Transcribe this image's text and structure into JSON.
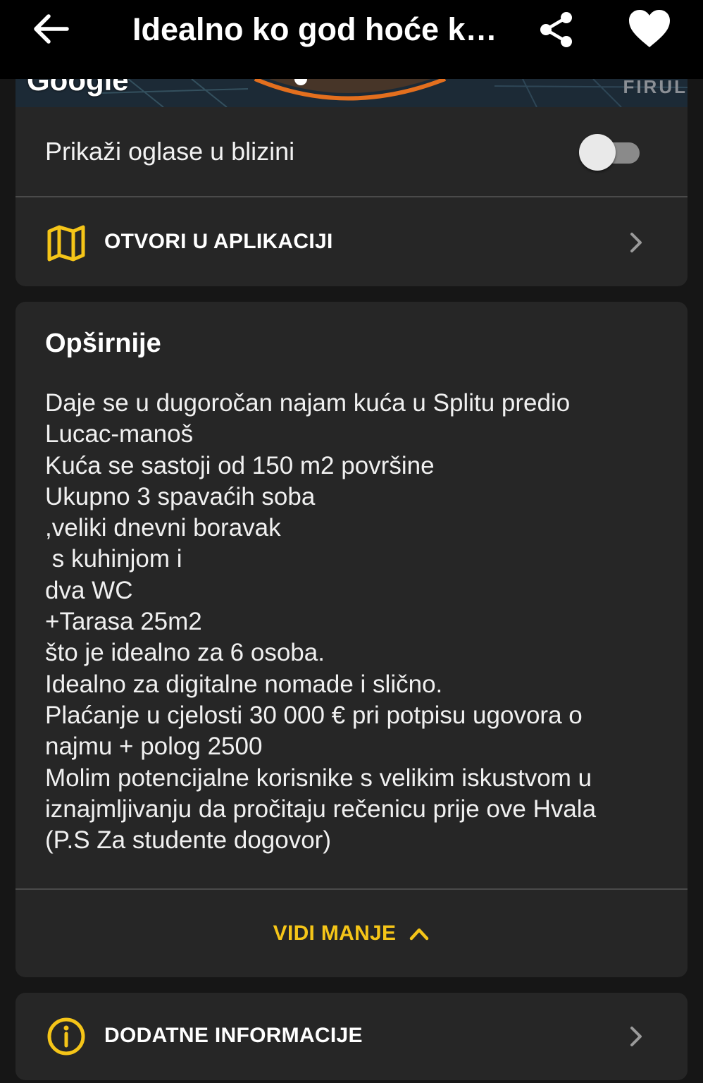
{
  "appbar": {
    "title": "Idealno ko god hoće ku..."
  },
  "map": {
    "brand": "Google",
    "place_label": "FIRUL"
  },
  "location_card": {
    "nearby_label": "Prikaži oglase u blizini",
    "nearby_enabled": false,
    "open_in_app_label": "OTVORI U APLIKACIJI"
  },
  "description": {
    "title": "Opširnije",
    "text": "Daje se u dugoročan najam kuća u Splitu predio\nLucac-manoš\nKuća se sastoji od 150 m2 površine\nUkupno 3 spavaćih soba\n,veliki dnevni boravak\n s kuhinjom i\ndva WC\n+Tarasa 25m2\nšto je idealno za 6 osoba.\nIdealno za digitalne nomade i slično.\nPlaćanje u cjelosti 30 000 € pri potpisu ugovora o\nnajmu + polog 2500\nMolim potencijalne korisnike s velikim iskustvom u\niznajmljivanju da pročitaju rečenicu prije ove Hvala\n(P.S Za studente dogovor)",
    "show_less_label": "VIDI MANJE"
  },
  "additional": {
    "label": "DODATNE INFORMACIJE"
  },
  "colors": {
    "accent": "#f5c518",
    "card": "#262626",
    "background": "#161616",
    "appbar": "#000000"
  }
}
